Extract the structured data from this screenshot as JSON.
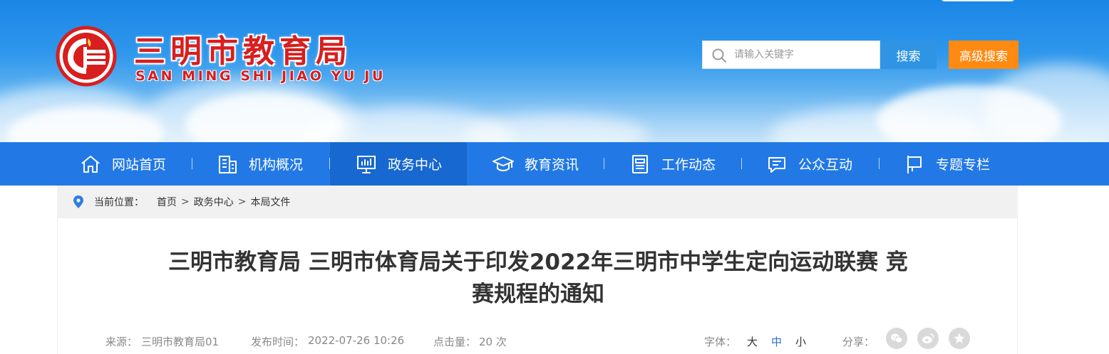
{
  "header": {
    "site_title": "三明市教育局",
    "site_subtitle": "SAN MING SHI JIAO YU JU",
    "search_placeholder": "请输入关键字",
    "search_label": "搜索",
    "advanced_search_label": "高级搜索",
    "brand_red": "#d81e1e",
    "search_blue": "#2f94e4",
    "advanced_orange": "#fe8a12"
  },
  "nav": {
    "color": "#2279e6",
    "active_color": "#1768d0",
    "items": [
      {
        "label": "网站首页",
        "icon": "home-icon"
      },
      {
        "label": "机构概况",
        "icon": "building-icon"
      },
      {
        "label": "政务中心",
        "icon": "presentation-board-icon",
        "active": true
      },
      {
        "label": "教育资讯",
        "icon": "graduation-cap-icon"
      },
      {
        "label": "工作动态",
        "icon": "document-list-icon"
      },
      {
        "label": "公众互动",
        "icon": "chat-bubble-icon"
      },
      {
        "label": "专题专栏",
        "icon": "flag-icon"
      }
    ]
  },
  "breadcrumb": {
    "prefix": "当前位置：",
    "items": [
      "首页",
      "政务中心",
      "本局文件"
    ],
    "separator": ">"
  },
  "article": {
    "title": "三明市教育局 三明市体育局关于印发2022年三明市中学生定向运动联赛 竞赛规程的通知",
    "source_label": "来源：",
    "source_value": "三明市教育局01",
    "publish_label": "发布时间：",
    "publish_value": "2022-07-26 10:26",
    "views_label": "点击量：",
    "views_value": "20 次",
    "font_label": "字体：",
    "font_sizes": [
      "大",
      "中",
      "小"
    ],
    "share_label": "分享：",
    "share_icons": [
      "wechat-icon",
      "weibo-icon",
      "favorite-star-icon"
    ]
  }
}
